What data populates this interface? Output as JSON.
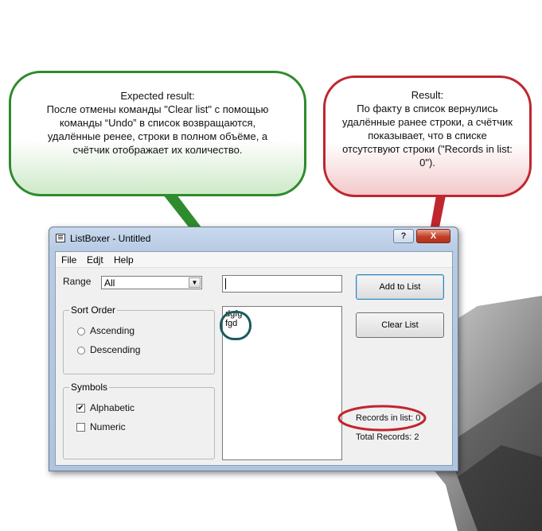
{
  "callouts": {
    "expected": {
      "title": "Expected result:",
      "text": "После отмены команды \"Clear list\" с помощью команды “Undo” в список возвращаются, удалённые ренее, строки в полном объёме, а счётчик отображает их количество."
    },
    "result": {
      "title": "Result:",
      "text": "По факту в список вернулись удалённые ранее строки, а счётчик показывает, что в списке отсутствуют строки (\"Records in list: 0\")."
    }
  },
  "window": {
    "title": "ListBoxer - Untitled",
    "help_button": "?",
    "close_button": "X"
  },
  "menu": {
    "file": "File",
    "edit": "Edjt",
    "help": "Help"
  },
  "range": {
    "label": "Range",
    "value": "All"
  },
  "sort_order": {
    "title": "Sort Order",
    "ascending": "Ascending",
    "descending": "Descending"
  },
  "symbols": {
    "title": "Symbols",
    "alphabetic": "Alphabetic",
    "alphabetic_checked": true,
    "numeric": "Numeric",
    "numeric_checked": false
  },
  "entry": {
    "value": ""
  },
  "list": {
    "items": [
      "dgfg",
      "fgd"
    ]
  },
  "buttons": {
    "add": "Add to List",
    "clear": "Clear List"
  },
  "status": {
    "records_in_list": "Records in list: 0",
    "total_records": "Total Records: 2"
  },
  "colors": {
    "expected_border": "#2e8b2e",
    "result_border": "#c0262d",
    "list_highlight": "#1b5b5e"
  }
}
